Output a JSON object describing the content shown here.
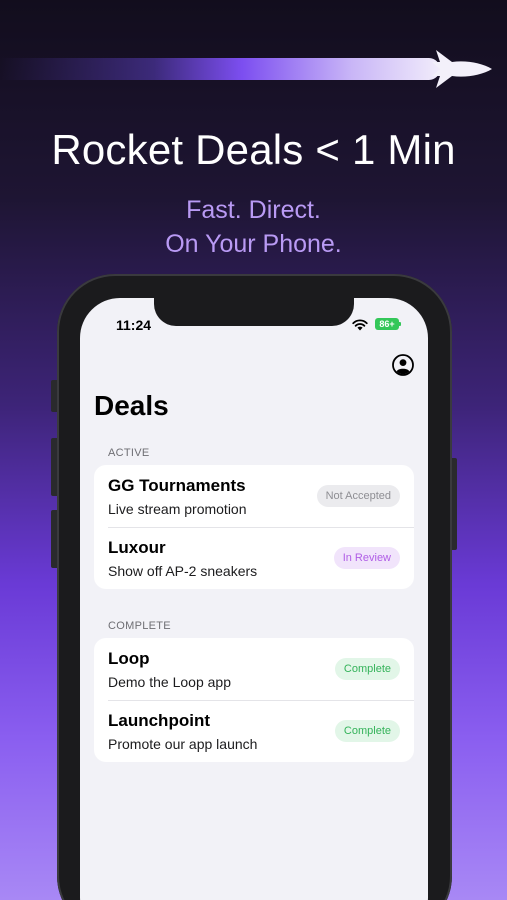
{
  "promo": {
    "headline": "Rocket Deals < 1 Min",
    "tagline_line1": "Fast. Direct.",
    "tagline_line2": "On Your Phone."
  },
  "status_bar": {
    "time": "11:24",
    "battery": "86+"
  },
  "app": {
    "title": "Deals",
    "profile_icon": "person-circle-icon"
  },
  "sections": {
    "active": {
      "header": "ACTIVE",
      "items": [
        {
          "title": "GG Tournaments",
          "subtitle": "Live stream promotion",
          "status": "Not Accepted"
        },
        {
          "title": "Luxour",
          "subtitle": "Show off AP-2 sneakers",
          "status": "In Review"
        }
      ]
    },
    "complete": {
      "header": "COMPLETE",
      "items": [
        {
          "title": "Loop",
          "subtitle": "Demo the Loop app",
          "status": "Complete"
        },
        {
          "title": "Launchpoint",
          "subtitle": "Promote our app launch",
          "status": "Complete"
        }
      ]
    }
  },
  "colors": {
    "status_not_accepted": "#8e8e93",
    "status_in_review": "#b05de6",
    "status_complete": "#34b35a",
    "accent_purple": "#7c4ef0"
  }
}
